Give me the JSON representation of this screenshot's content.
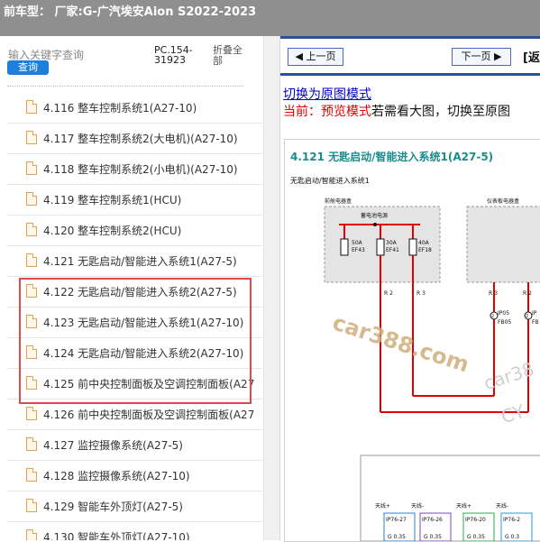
{
  "header": {
    "title": "前车型： 厂家:G-广汽埃安Aion S2022-2023"
  },
  "sidebar": {
    "search_label": "输入关键字查询",
    "query_button": "查询",
    "pc_code": "PC.154-31923",
    "collapse_all": "折叠全部",
    "items": [
      {
        "label": "4.116 整车控制系统1(A27-10)"
      },
      {
        "label": "4.117 整车控制系统2(大电机)(A27-10)"
      },
      {
        "label": "4.118 整车控制系统2(小电机)(A27-10)"
      },
      {
        "label": "4.119 整车控制系统1(HCU)"
      },
      {
        "label": "4.120 整车控制系统2(HCU)"
      },
      {
        "label": "4.121 无匙启动/智能进入系统1(A27-5)"
      },
      {
        "label": "4.122 无匙启动/智能进入系统2(A27-5)"
      },
      {
        "label": "4.123 无匙启动/智能进入系统1(A27-10)"
      },
      {
        "label": "4.124 无匙启动/智能进入系统2(A27-10)"
      },
      {
        "label": "4.125 前中央控制面板及空调控制面板(A27"
      },
      {
        "label": "4.126 前中央控制面板及空调控制面板(A27"
      },
      {
        "label": "4.127 监控摄像系统(A27-5)"
      },
      {
        "label": "4.128 监控摄像系统(A27-10)"
      },
      {
        "label": "4.129 智能车外顶灯(A27-5)"
      },
      {
        "label": "4.130 智能车外顶灯(A27-10)"
      }
    ]
  },
  "viewer": {
    "prev_button": "上一页",
    "next_button": "下一页",
    "extra_label": "[返",
    "switch_link": "切换为原图模式",
    "mode_prefix": "当前：",
    "mode_value": "预览模式",
    "mode_hint": "若需看大图，切换至原图",
    "diagram_title": "4.121 无匙启动/智能进入系统1(A27-5)",
    "diagram_subtitle": "无匙启动/智能进入系统1",
    "box_front": "前舱电器盒",
    "box_panel": "仪表板电器盒",
    "battery": "蓄电池电源",
    "fuses": [
      {
        "amp": "50A",
        "code": "EF43"
      },
      {
        "amp": "30A",
        "code": "EF41"
      },
      {
        "amp": "40A",
        "code": "EF18"
      }
    ],
    "wire_r2": "R 2",
    "wire_r3": "R 3",
    "wire_r3b": "R 3",
    "wire_r2b": "R 2",
    "conn_num": "2",
    "conn_ip": "IP05",
    "conn_fb": "FB05",
    "conn_num2": "2",
    "conn_ip2": "IP",
    "conn_fb2": "FB",
    "antennas": [
      "天线+",
      "天线-",
      "天线+",
      "天线-"
    ],
    "bottom_connectors": [
      "IP76-27",
      "IP76-26",
      "IP76-20",
      "IP76-2"
    ],
    "bottom_wires": [
      "G 0.35",
      "G 0.35",
      "G 0.35",
      "G 0.3"
    ],
    "watermark": "car388.com",
    "watermark2": "car38",
    "watermark3": "CY"
  },
  "colors": {
    "topbar_bg": "#8f8f8f",
    "query_button_bg": "#1f7fd8",
    "highlight_border": "#e24a4a",
    "wire_red": "#e00000",
    "nav_blue": "#2f4f9a",
    "link_blue": "#0000cc",
    "title_teal": "#1a8c8c"
  }
}
